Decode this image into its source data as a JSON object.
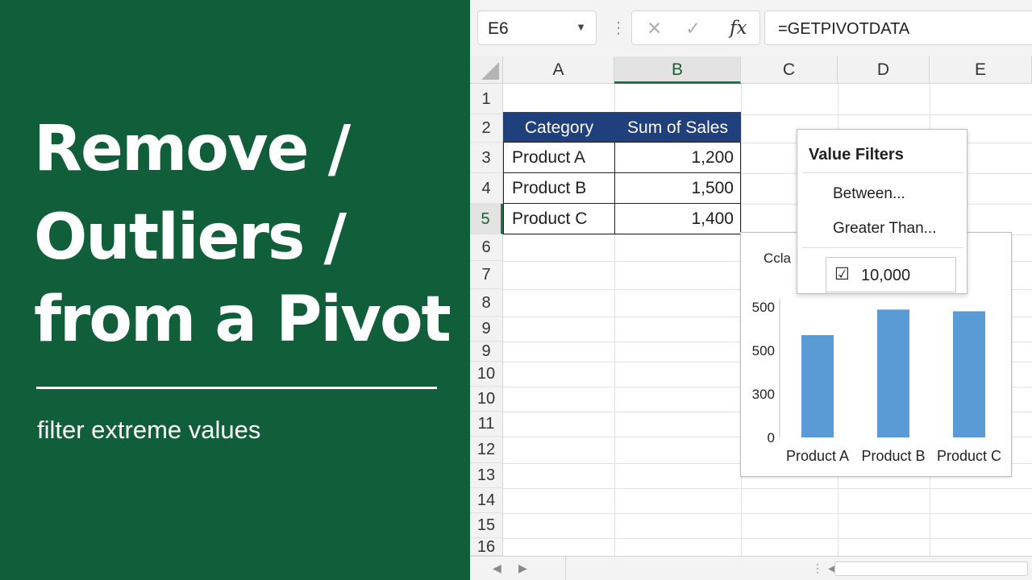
{
  "banner": {
    "title_lines": [
      "Remove /",
      "Outliers /",
      "from a Pivot"
    ],
    "subtitle": "filter extreme values",
    "background": "#115e3a"
  },
  "formula_bar": {
    "name_box": "E6",
    "cancel_icon": "cancel-x-icon",
    "enter_icon": "enter-check-icon",
    "fx_label": "fx",
    "formula": "=GETPIVOTDATA"
  },
  "grid": {
    "columns": [
      "A",
      "B",
      "C",
      "D",
      "E"
    ],
    "selected_column": "B",
    "rows": [
      "1",
      "2",
      "3",
      "4",
      "5",
      "6",
      "7",
      "8",
      "9",
      "9",
      "10",
      "10",
      "11",
      "12",
      "13",
      "14",
      "15",
      "16"
    ],
    "selected_row": "5"
  },
  "pivot": {
    "headers": [
      "Category",
      "Sum of Sales"
    ],
    "rows": [
      [
        "Product A",
        "1,200"
      ],
      [
        "Product B",
        "1,500"
      ],
      [
        "Product C",
        "1,400"
      ]
    ],
    "header_color": "#1f3f7d"
  },
  "value_filter": {
    "title": "Value Filters",
    "items": [
      "Between...",
      "Greater Than..."
    ],
    "value": "10,000",
    "checkbox": "☑"
  },
  "chart_data": {
    "type": "bar",
    "title": "Ccla",
    "categories": [
      "Product A",
      "Product B",
      "Product C"
    ],
    "values": [
      1200,
      1500,
      1480
    ],
    "ytick_labels": [
      "500",
      "500",
      "300",
      "0"
    ],
    "bar_color": "#5b9bd5",
    "legend": "none",
    "grid": false
  }
}
